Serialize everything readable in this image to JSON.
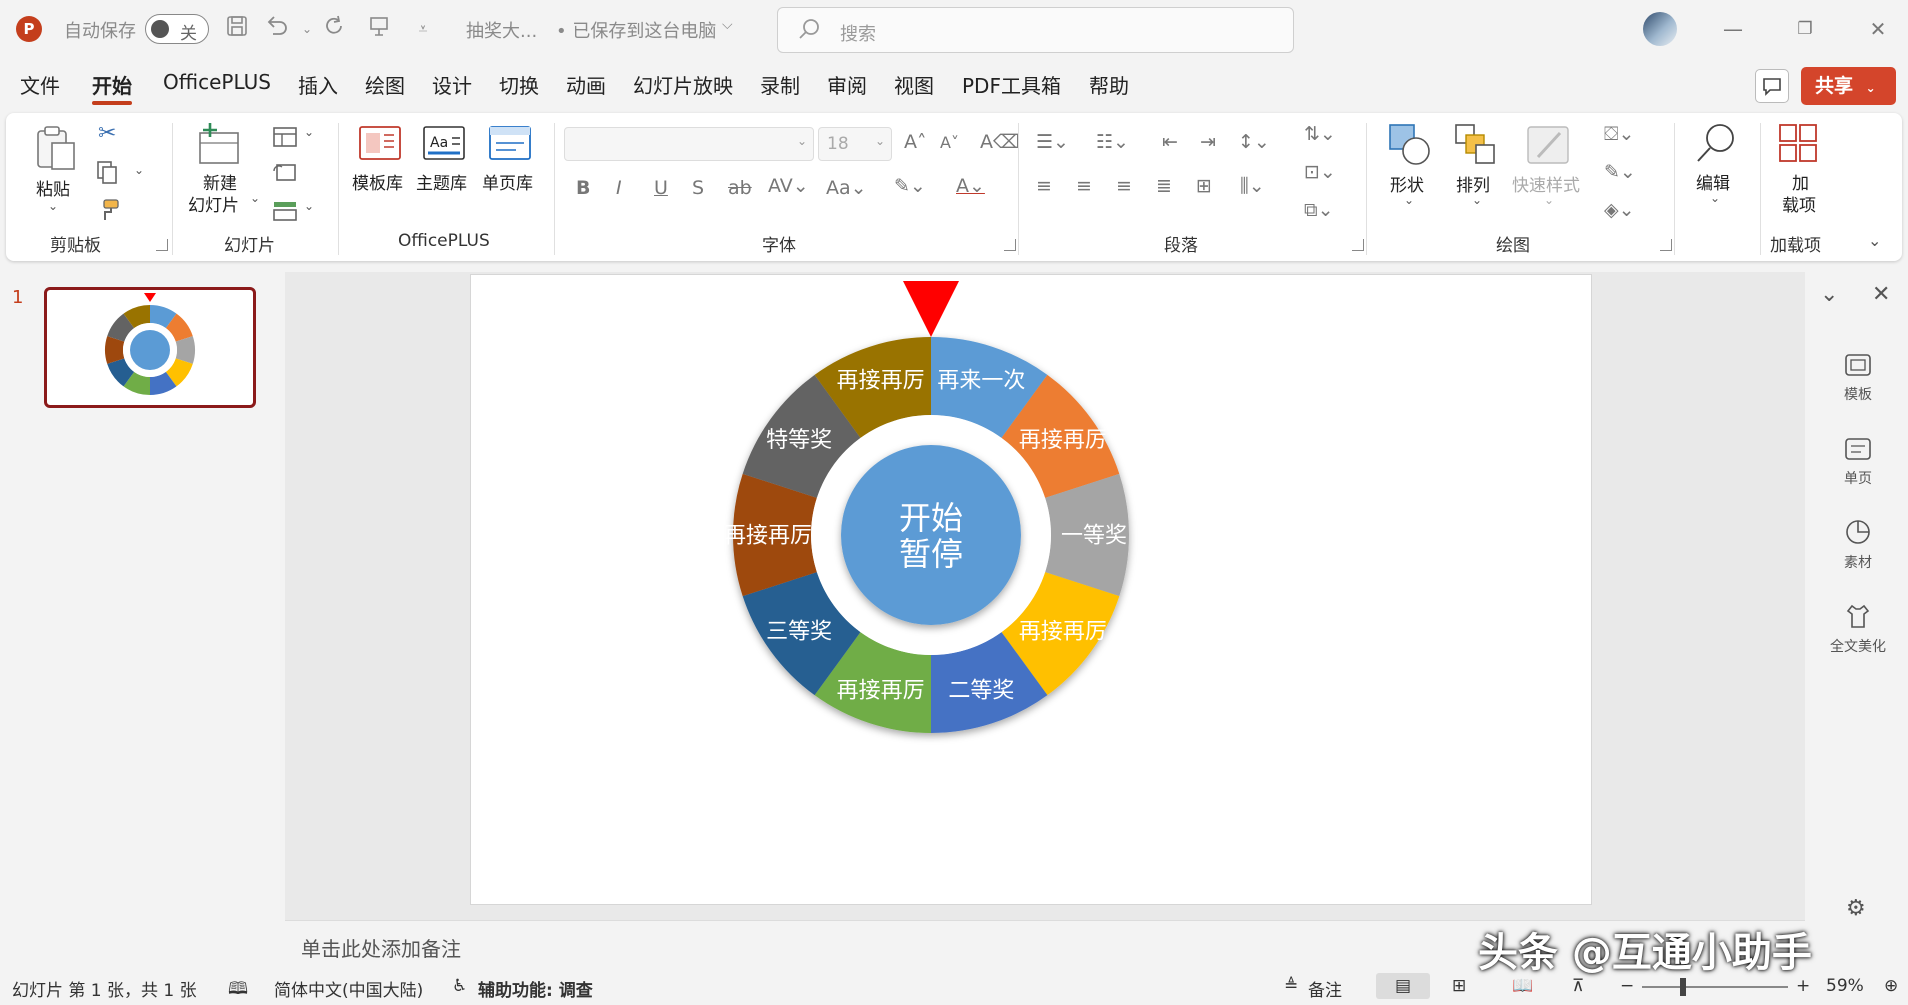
{
  "titlebar": {
    "autosave_label": "自动保存",
    "autosave_state": "关",
    "file_name": "抽奖大...",
    "save_status": "• 已保存到这台电脑",
    "search_placeholder": "搜索"
  },
  "tabs": [
    {
      "label": "文件",
      "active": false
    },
    {
      "label": "开始",
      "active": true
    },
    {
      "label": "OfficePLUS",
      "active": false
    },
    {
      "label": "插入",
      "active": false
    },
    {
      "label": "绘图",
      "active": false
    },
    {
      "label": "设计",
      "active": false
    },
    {
      "label": "切换",
      "active": false
    },
    {
      "label": "动画",
      "active": false
    },
    {
      "label": "幻灯片放映",
      "active": false
    },
    {
      "label": "录制",
      "active": false
    },
    {
      "label": "审阅",
      "active": false
    },
    {
      "label": "视图",
      "active": false
    },
    {
      "label": "PDF工具箱",
      "active": false
    },
    {
      "label": "帮助",
      "active": false
    }
  ],
  "share_label": "共享",
  "ribbon": {
    "clipboard": {
      "paste": "粘贴",
      "group": "剪贴板"
    },
    "slides": {
      "new_slide_1": "新建",
      "new_slide_2": "幻灯片",
      "group": "幻灯片"
    },
    "officeplus": {
      "template_lib": "模板库",
      "theme_lib": "主题库",
      "single_page_lib": "单页库",
      "group": "OfficePLUS"
    },
    "font": {
      "size": "18",
      "group": "字体"
    },
    "paragraph": {
      "group": "段落"
    },
    "drawing": {
      "shapes": "形状",
      "arrange": "排列",
      "quick_styles": "快速样式",
      "group": "绘图"
    },
    "edit": {
      "label": "编辑"
    },
    "addins": {
      "line1": "加",
      "line2": "载项",
      "group": "加载项"
    }
  },
  "slide_pane": {
    "slide_number": "1"
  },
  "wheel": {
    "center_line1": "开始",
    "center_line2": "暂停",
    "segments": [
      {
        "label": "再来一次",
        "color": "#5b9bd5"
      },
      {
        "label": "再接再厉",
        "color": "#ed7d31"
      },
      {
        "label": "一等奖",
        "color": "#a5a5a5"
      },
      {
        "label": "再接再厉",
        "color": "#ffc000"
      },
      {
        "label": "二等奖",
        "color": "#4472c4"
      },
      {
        "label": "再接再厉",
        "color": "#70ad47"
      },
      {
        "label": "三等奖",
        "color": "#255e91"
      },
      {
        "label": "再接再厉",
        "color": "#9e480e"
      },
      {
        "label": "特等奖",
        "color": "#636363"
      },
      {
        "label": "再接再厉",
        "color": "#997300"
      }
    ],
    "center_color": "#5b9bd5",
    "pointer_color": "#ff0000"
  },
  "notes_placeholder": "单击此处添加备注",
  "right_rail": [
    {
      "label": "模板",
      "icon": "template-icon"
    },
    {
      "label": "单页",
      "icon": "single-page-icon"
    },
    {
      "label": "素材",
      "icon": "material-icon"
    },
    {
      "label": "全文美化",
      "icon": "beautify-icon"
    }
  ],
  "status": {
    "slide_info": "幻灯片 第 1 张，共 1 张",
    "language": "简体中文(中国大陆)",
    "accessibility": "辅助功能: 调查",
    "notes": "备注",
    "zoom": "59%"
  },
  "watermark": "头条 @互通小助手"
}
